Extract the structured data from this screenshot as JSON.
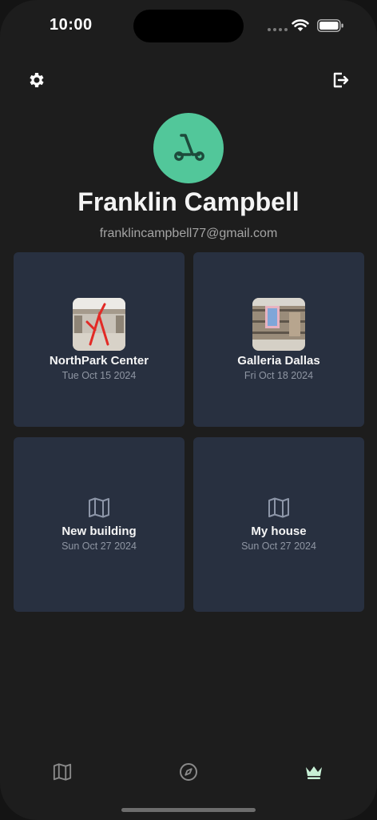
{
  "status_bar": {
    "time": "10:00"
  },
  "profile": {
    "name": "Franklin Campbell",
    "email": "franklincampbell77@gmail.com",
    "avatar_icon": "scooter-icon",
    "avatar_color": "#52c79a"
  },
  "cards": [
    {
      "title": "NorthPark Center",
      "date": "Tue Oct 15 2024",
      "icon": "photo-thumbnail"
    },
    {
      "title": "Galleria Dallas",
      "date": "Fri Oct 18 2024",
      "icon": "photo-thumbnail"
    },
    {
      "title": "New building",
      "date": "Sun Oct 27 2024",
      "icon": "map-icon"
    },
    {
      "title": "My house",
      "date": "Sun Oct 27 2024",
      "icon": "map-icon"
    }
  ],
  "tabbar": {
    "tabs": [
      {
        "icon": "map-icon",
        "active": false
      },
      {
        "icon": "compass-icon",
        "active": false
      },
      {
        "icon": "crown-icon",
        "active": true
      }
    ],
    "active_color": "#c8f0d6",
    "inactive_color": "#8a8a8a"
  }
}
